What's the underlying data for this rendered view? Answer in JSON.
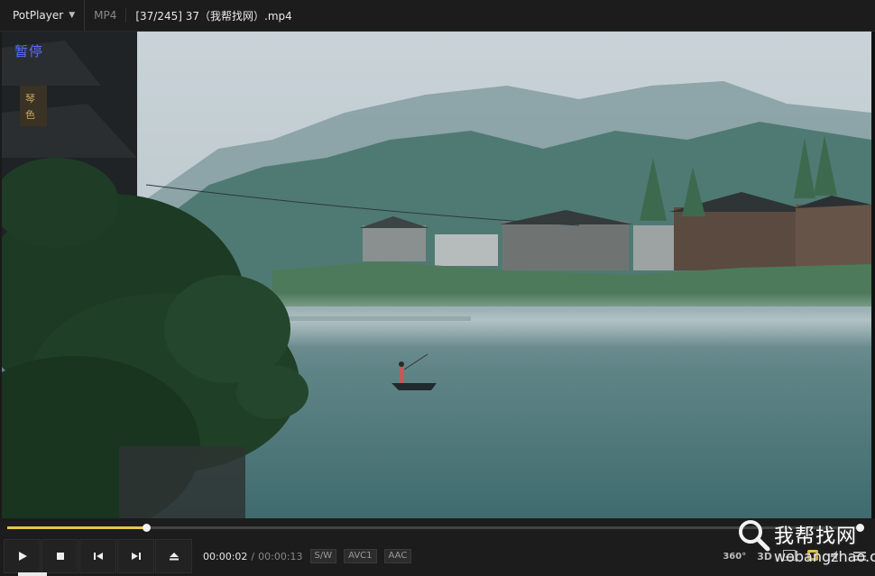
{
  "titlebar": {
    "app_name": "PotPlayer",
    "format": "MP4",
    "filename": "[37/245] 37（我帮找网）.mp4"
  },
  "osd": {
    "state_text": "暂停"
  },
  "video": {
    "sign_text": "琴色",
    "scene_icons": [
      "boat-icon",
      "house-icon",
      "tree-icon",
      "mountain-icon"
    ]
  },
  "seek": {
    "progress_fraction": 0.162
  },
  "controls": {
    "current_time": "00:00:02",
    "separator": "/",
    "total_time": "00:00:13",
    "tags": [
      "S/W",
      "AVC1",
      "AAC"
    ],
    "right": {
      "vr": "360°",
      "three_d": "3D"
    }
  },
  "watermark": {
    "text": "我帮找网",
    "url": "wobangzhao.com"
  },
  "colors": {
    "accent": "#e6c54a",
    "osd": "#5a6cff",
    "bar": "#1c1c1c"
  }
}
